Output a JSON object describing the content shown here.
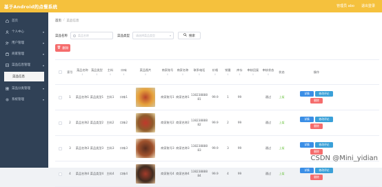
{
  "topbar": {
    "title": "基于Android的点餐系统",
    "links": [
      "管理员 abo",
      "退出登录"
    ]
  },
  "sidebar": {
    "items": [
      {
        "label": "首页",
        "icon": "home-icon"
      },
      {
        "label": "个人中心",
        "icon": "user-icon",
        "arrow": true
      },
      {
        "label": "用户管理",
        "icon": "users-icon",
        "arrow": true
      },
      {
        "label": "商家管理",
        "icon": "shop-icon",
        "arrow": true
      },
      {
        "label": "菜品信息管理",
        "icon": "food-icon",
        "arrow": true
      }
    ],
    "active_sub": "菜品信息",
    "items_after": [
      {
        "label": "菜品分类管理",
        "icon": "category-icon",
        "arrow": true
      },
      {
        "label": "系统管理",
        "icon": "settings-icon",
        "arrow": true
      }
    ]
  },
  "breadcrumb": {
    "home": "首页",
    "sep": "/",
    "current": "菜品信息"
  },
  "search": {
    "name_label": "菜品名称",
    "name_placeholder": "菜品名称",
    "type_label": "菜品类型",
    "type_placeholder": "请选择菜品类型",
    "search_button": "搜索"
  },
  "delete_button": "删除",
  "table": {
    "headers": [
      {
        "label": "索引",
        "sort": false
      },
      {
        "label": "菜品名称",
        "sort": true
      },
      {
        "label": "菜品类型",
        "sort": true
      },
      {
        "label": "主料",
        "sort": true
      },
      {
        "label": "口味",
        "sort": true
      },
      {
        "label": "菜品图片",
        "sort": true
      },
      {
        "label": "商家账号",
        "sort": true
      },
      {
        "label": "商家名称",
        "sort": true
      },
      {
        "label": "联系电话",
        "sort": true
      },
      {
        "label": "价格",
        "sort": true
      },
      {
        "label": "销量",
        "sort": true
      },
      {
        "label": "库存",
        "sort": true
      },
      {
        "label": "审核回复",
        "sort": true
      },
      {
        "label": "审核状态",
        "sort": true
      },
      {
        "label": "状态",
        "sort": false
      },
      {
        "label": "操作",
        "sort": false
      }
    ],
    "rows": [
      {
        "index": "1",
        "name": "菜品名称1",
        "type": "菜品类型1",
        "main": "主料1",
        "taste": "口味1",
        "account": "商家账号1",
        "shop": "商家名称1",
        "phone": "13823888881",
        "price": "99.9",
        "sales": "1",
        "stock": "99",
        "reply": "",
        "audit": "通过",
        "state": "上架"
      },
      {
        "index": "2",
        "name": "菜品名称2",
        "type": "菜品类型2",
        "main": "主料2",
        "taste": "口味2",
        "account": "商家账号2",
        "shop": "商家名称2",
        "phone": "13823888882",
        "price": "99.9",
        "sales": "2",
        "stock": "99",
        "reply": "",
        "audit": "通过",
        "state": "上架"
      },
      {
        "index": "3",
        "name": "菜品名称3",
        "type": "菜品类型3",
        "main": "主料3",
        "taste": "口味3",
        "account": "商家账号3",
        "shop": "商家名称3",
        "phone": "13823888883",
        "price": "99.9",
        "sales": "3",
        "stock": "99",
        "reply": "",
        "audit": "通过",
        "state": "上架"
      },
      {
        "index": "4",
        "name": "菜品名称4",
        "type": "菜品类型4",
        "main": "主料4",
        "taste": "口味4",
        "account": "商家账号4",
        "shop": "商家名称4",
        "phone": "13823888884",
        "price": "99.9",
        "sales": "4",
        "stock": "99",
        "reply": "",
        "audit": "通过",
        "state": "上架"
      }
    ],
    "ops": {
      "detail": "详情",
      "edit": "修改评论",
      "delete": "删除"
    }
  },
  "watermark": "CSDN @Mini_yidian",
  "colors": {
    "topbar": "#f5c13d",
    "sidebar": "#304156",
    "primary": "#3a8ee6",
    "danger": "#f56c6c",
    "success": "#67c23a"
  }
}
